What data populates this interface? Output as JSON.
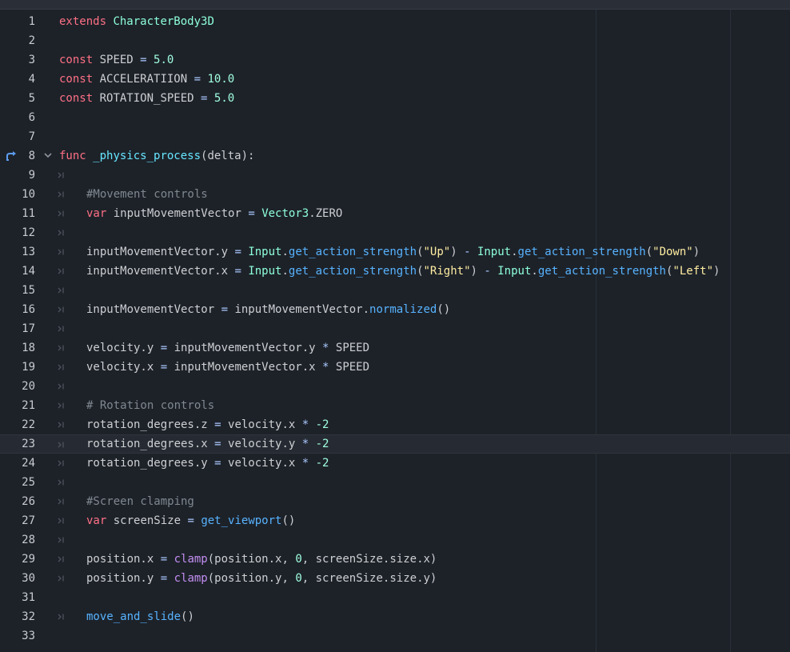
{
  "colors": {
    "background": "#1d2229",
    "keyword": "#ff7085",
    "type": "#8effda",
    "number": "#a1ffe0",
    "function": "#57b3ff",
    "string": "#ffeda1",
    "comment": "#808890",
    "builtin": "#c38ef1"
  },
  "gutter": {
    "override_icon": "override-arrow-icon",
    "fold_icon": "chevron-down-icon",
    "tab_icon": "tab-indent-icon"
  },
  "editor": {
    "current_line": 23,
    "lines": [
      {
        "n": "1",
        "tokens": [
          {
            "t": "extends",
            "c": "kw"
          },
          {
            "t": " ",
            "c": "tx"
          },
          {
            "t": "CharacterBody3D",
            "c": "ty"
          }
        ]
      },
      {
        "n": "2",
        "tokens": []
      },
      {
        "n": "3",
        "tokens": [
          {
            "t": "const",
            "c": "kw"
          },
          {
            "t": " SPEED ",
            "c": "tx"
          },
          {
            "t": "=",
            "c": "op"
          },
          {
            "t": " ",
            "c": "tx"
          },
          {
            "t": "5.0",
            "c": "num"
          }
        ]
      },
      {
        "n": "4",
        "tokens": [
          {
            "t": "const",
            "c": "kw"
          },
          {
            "t": " ACCELERATIION ",
            "c": "tx"
          },
          {
            "t": "=",
            "c": "op"
          },
          {
            "t": " ",
            "c": "tx"
          },
          {
            "t": "10.0",
            "c": "num"
          }
        ]
      },
      {
        "n": "5",
        "tokens": [
          {
            "t": "const",
            "c": "kw"
          },
          {
            "t": " ROTATION_SPEED ",
            "c": "tx"
          },
          {
            "t": "=",
            "c": "op"
          },
          {
            "t": " ",
            "c": "tx"
          },
          {
            "t": "5.0",
            "c": "num"
          }
        ]
      },
      {
        "n": "6",
        "tokens": []
      },
      {
        "n": "7",
        "tokens": []
      },
      {
        "n": "8",
        "icon": true,
        "fold": true,
        "tokens": [
          {
            "t": "func",
            "c": "kw"
          },
          {
            "t": " ",
            "c": "tx"
          },
          {
            "t": "_physics_process",
            "c": "fnu"
          },
          {
            "t": "(delta):",
            "c": "tx"
          }
        ]
      },
      {
        "n": "9",
        "tab": true,
        "tokens": []
      },
      {
        "n": "10",
        "tab": true,
        "indent": true,
        "tokens": [
          {
            "t": "#Movement controls",
            "c": "com"
          }
        ]
      },
      {
        "n": "11",
        "tab": true,
        "indent": true,
        "tokens": [
          {
            "t": "var",
            "c": "kw"
          },
          {
            "t": " inputMovementVector ",
            "c": "tx"
          },
          {
            "t": "=",
            "c": "op"
          },
          {
            "t": " ",
            "c": "tx"
          },
          {
            "t": "Vector3",
            "c": "ty"
          },
          {
            "t": ".ZERO",
            "c": "tx"
          }
        ]
      },
      {
        "n": "12",
        "tab": true,
        "tokens": []
      },
      {
        "n": "13",
        "tab": true,
        "indent": true,
        "tokens": [
          {
            "t": "inputMovementVector.y ",
            "c": "tx"
          },
          {
            "t": "=",
            "c": "op"
          },
          {
            "t": " ",
            "c": "tx"
          },
          {
            "t": "Input",
            "c": "ty"
          },
          {
            "t": ".",
            "c": "tx"
          },
          {
            "t": "get_action_strength",
            "c": "fn"
          },
          {
            "t": "(",
            "c": "tx"
          },
          {
            "t": "\"Up\"",
            "c": "str"
          },
          {
            "t": ") ",
            "c": "tx"
          },
          {
            "t": "-",
            "c": "op"
          },
          {
            "t": " ",
            "c": "tx"
          },
          {
            "t": "Input",
            "c": "ty"
          },
          {
            "t": ".",
            "c": "tx"
          },
          {
            "t": "get_action_strength",
            "c": "fn"
          },
          {
            "t": "(",
            "c": "tx"
          },
          {
            "t": "\"Down\"",
            "c": "str"
          },
          {
            "t": ")",
            "c": "tx"
          }
        ]
      },
      {
        "n": "14",
        "tab": true,
        "indent": true,
        "tokens": [
          {
            "t": "inputMovementVector.x ",
            "c": "tx"
          },
          {
            "t": "=",
            "c": "op"
          },
          {
            "t": " ",
            "c": "tx"
          },
          {
            "t": "Input",
            "c": "ty"
          },
          {
            "t": ".",
            "c": "tx"
          },
          {
            "t": "get_action_strength",
            "c": "fn"
          },
          {
            "t": "(",
            "c": "tx"
          },
          {
            "t": "\"Right\"",
            "c": "str"
          },
          {
            "t": ") ",
            "c": "tx"
          },
          {
            "t": "-",
            "c": "op"
          },
          {
            "t": " ",
            "c": "tx"
          },
          {
            "t": "Input",
            "c": "ty"
          },
          {
            "t": ".",
            "c": "tx"
          },
          {
            "t": "get_action_strength",
            "c": "fn"
          },
          {
            "t": "(",
            "c": "tx"
          },
          {
            "t": "\"Left\"",
            "c": "str"
          },
          {
            "t": ")",
            "c": "tx"
          }
        ]
      },
      {
        "n": "15",
        "tab": true,
        "tokens": []
      },
      {
        "n": "16",
        "tab": true,
        "indent": true,
        "tokens": [
          {
            "t": "inputMovementVector ",
            "c": "tx"
          },
          {
            "t": "=",
            "c": "op"
          },
          {
            "t": " inputMovementVector.",
            "c": "tx"
          },
          {
            "t": "normalized",
            "c": "fn"
          },
          {
            "t": "()",
            "c": "tx"
          }
        ]
      },
      {
        "n": "17",
        "tab": true,
        "tokens": []
      },
      {
        "n": "18",
        "tab": true,
        "indent": true,
        "tokens": [
          {
            "t": "velocity.y ",
            "c": "tx"
          },
          {
            "t": "=",
            "c": "op"
          },
          {
            "t": " inputMovementVector.y ",
            "c": "tx"
          },
          {
            "t": "*",
            "c": "op"
          },
          {
            "t": " SPEED",
            "c": "tx"
          }
        ]
      },
      {
        "n": "19",
        "tab": true,
        "indent": true,
        "tokens": [
          {
            "t": "velocity.x ",
            "c": "tx"
          },
          {
            "t": "=",
            "c": "op"
          },
          {
            "t": " inputMovementVector.x ",
            "c": "tx"
          },
          {
            "t": "*",
            "c": "op"
          },
          {
            "t": " SPEED",
            "c": "tx"
          }
        ]
      },
      {
        "n": "20",
        "tab": true,
        "tokens": []
      },
      {
        "n": "21",
        "tab": true,
        "indent": true,
        "tokens": [
          {
            "t": "# Rotation controls",
            "c": "com"
          }
        ]
      },
      {
        "n": "22",
        "tab": true,
        "indent": true,
        "tokens": [
          {
            "t": "rotation_degrees.z ",
            "c": "tx"
          },
          {
            "t": "=",
            "c": "op"
          },
          {
            "t": " velocity.x ",
            "c": "tx"
          },
          {
            "t": "*",
            "c": "op"
          },
          {
            "t": " ",
            "c": "tx"
          },
          {
            "t": "-2",
            "c": "num"
          }
        ]
      },
      {
        "n": "23",
        "tab": true,
        "indent": true,
        "tokens": [
          {
            "t": "rotation_degrees.x ",
            "c": "tx"
          },
          {
            "t": "=",
            "c": "op"
          },
          {
            "t": " velocity.y ",
            "c": "tx"
          },
          {
            "t": "*",
            "c": "op"
          },
          {
            "t": " ",
            "c": "tx"
          },
          {
            "t": "-2",
            "c": "num"
          }
        ]
      },
      {
        "n": "24",
        "tab": true,
        "indent": true,
        "tokens": [
          {
            "t": "rotation_degrees.y ",
            "c": "tx"
          },
          {
            "t": "=",
            "c": "op"
          },
          {
            "t": " velocity.x ",
            "c": "tx"
          },
          {
            "t": "*",
            "c": "op"
          },
          {
            "t": " ",
            "c": "tx"
          },
          {
            "t": "-2",
            "c": "num"
          }
        ]
      },
      {
        "n": "25",
        "tab": true,
        "tokens": []
      },
      {
        "n": "26",
        "tab": true,
        "indent": true,
        "tokens": [
          {
            "t": "#Screen clamping",
            "c": "com"
          }
        ]
      },
      {
        "n": "27",
        "tab": true,
        "indent": true,
        "tokens": [
          {
            "t": "var",
            "c": "kw"
          },
          {
            "t": " screenSize ",
            "c": "tx"
          },
          {
            "t": "=",
            "c": "op"
          },
          {
            "t": " ",
            "c": "tx"
          },
          {
            "t": "get_viewport",
            "c": "fn"
          },
          {
            "t": "()",
            "c": "tx"
          }
        ]
      },
      {
        "n": "28",
        "tab": true,
        "tokens": []
      },
      {
        "n": "29",
        "tab": true,
        "indent": true,
        "tokens": [
          {
            "t": "position.x ",
            "c": "tx"
          },
          {
            "t": "=",
            "c": "op"
          },
          {
            "t": " ",
            "c": "tx"
          },
          {
            "t": "clamp",
            "c": "bi"
          },
          {
            "t": "(position.x, ",
            "c": "tx"
          },
          {
            "t": "0",
            "c": "num"
          },
          {
            "t": ", screenSize.",
            "c": "tx"
          },
          {
            "t": "size",
            "c": "tx"
          },
          {
            "t": ".x)",
            "c": "tx"
          }
        ]
      },
      {
        "n": "30",
        "tab": true,
        "indent": true,
        "tokens": [
          {
            "t": "position.y ",
            "c": "tx"
          },
          {
            "t": "=",
            "c": "op"
          },
          {
            "t": " ",
            "c": "tx"
          },
          {
            "t": "clamp",
            "c": "bi"
          },
          {
            "t": "(position.y, ",
            "c": "tx"
          },
          {
            "t": "0",
            "c": "num"
          },
          {
            "t": ", screenSize.",
            "c": "tx"
          },
          {
            "t": "size",
            "c": "tx"
          },
          {
            "t": ".y)",
            "c": "tx"
          }
        ]
      },
      {
        "n": "31",
        "tokens": []
      },
      {
        "n": "32",
        "tab": true,
        "indent": true,
        "tokens": [
          {
            "t": "move_and_slide",
            "c": "fn"
          },
          {
            "t": "()",
            "c": "tx"
          }
        ]
      },
      {
        "n": "33",
        "tokens": []
      }
    ]
  }
}
